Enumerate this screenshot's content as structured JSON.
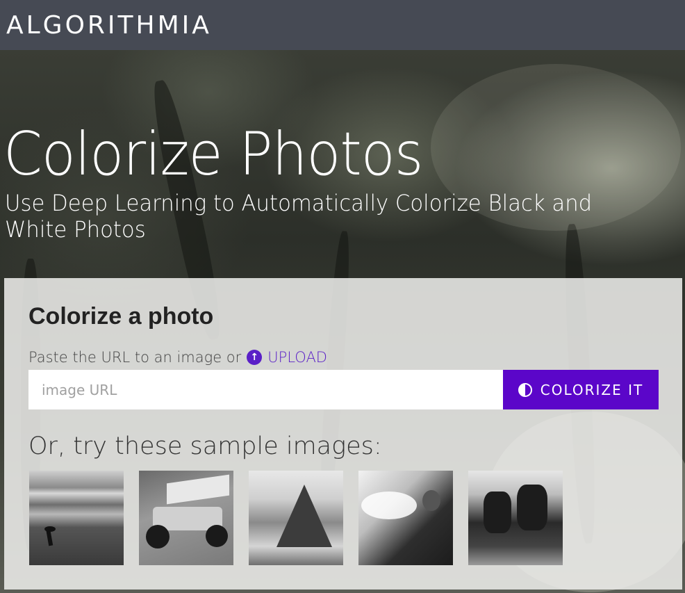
{
  "header": {
    "logo_text": "ALGORITHMIA"
  },
  "hero": {
    "title": "Colorize Photos",
    "subtitle": "Use Deep Learning to Automatically Colorize Black and White Photos"
  },
  "panel": {
    "title": "Colorize a photo",
    "paste_text": "Paste the URL to an image or",
    "upload_label": "UPLOAD",
    "url_placeholder": "image URL",
    "url_value": "",
    "colorize_label": "COLORIZE IT",
    "samples_label": "Or, try these sample images:"
  },
  "samples": [
    {
      "name": "bird on beach",
      "icon": "sample-beach-bird"
    },
    {
      "name": "sprint car",
      "icon": "sample-race-car"
    },
    {
      "name": "mountain dome",
      "icon": "sample-mountain"
    },
    {
      "name": "fire breather",
      "icon": "sample-fire-breather"
    },
    {
      "name": "cows in field",
      "icon": "sample-cows"
    }
  ],
  "colors": {
    "header_bg": "#464a54",
    "accent": "#5b06c9",
    "link": "#5a1fc7"
  }
}
